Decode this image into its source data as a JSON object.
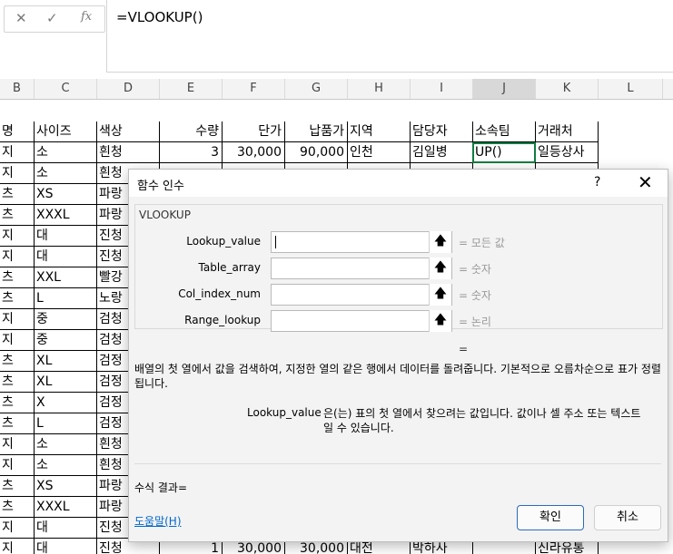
{
  "formula_bar": {
    "cancel_icon": "✕",
    "enter_icon": "✓",
    "fx_icon": "fx",
    "formula": "=VLOOKUP()"
  },
  "columns": [
    "B",
    "C",
    "D",
    "E",
    "F",
    "G",
    "H",
    "I",
    "J",
    "K",
    "L"
  ],
  "selected_column": "J",
  "header_row": [
    "명",
    "사이즈",
    "색상",
    "수량",
    "단가",
    "납품가",
    "지역",
    "담당자",
    "소속팀",
    "거래처"
  ],
  "rows": [
    [
      "지",
      "소",
      "흰청",
      "3",
      "30,000",
      "90,000",
      "인천",
      "김일병",
      "UP()",
      "일등상사"
    ],
    [
      "지",
      "소",
      "흰청",
      "",
      "",
      "",
      "",
      "",
      "",
      ""
    ],
    [
      "츠",
      "XS",
      "파랑",
      "",
      "",
      "",
      "",
      "",
      "",
      ""
    ],
    [
      "츠",
      "XXXL",
      "파랑",
      "",
      "",
      "",
      "",
      "",
      "",
      ""
    ],
    [
      "지",
      "대",
      "진청",
      "",
      "",
      "",
      "",
      "",
      "",
      ""
    ],
    [
      "지",
      "대",
      "진청",
      "",
      "",
      "",
      "",
      "",
      "",
      ""
    ],
    [
      "츠",
      "XXL",
      "빨강",
      "",
      "",
      "",
      "",
      "",
      "",
      ""
    ],
    [
      "츠",
      "L",
      "노랑",
      "",
      "",
      "",
      "",
      "",
      "",
      ""
    ],
    [
      "지",
      "중",
      "검청",
      "",
      "",
      "",
      "",
      "",
      "",
      ""
    ],
    [
      "지",
      "중",
      "검청",
      "",
      "",
      "",
      "",
      "",
      "",
      ""
    ],
    [
      "츠",
      "XL",
      "검정",
      "",
      "",
      "",
      "",
      "",
      "",
      ""
    ],
    [
      "츠",
      "XL",
      "검정",
      "",
      "",
      "",
      "",
      "",
      "",
      ""
    ],
    [
      "츠",
      "X",
      "검정",
      "",
      "",
      "",
      "",
      "",
      "",
      ""
    ],
    [
      "츠",
      "L",
      "검정",
      "",
      "",
      "",
      "",
      "",
      "",
      ""
    ],
    [
      "지",
      "소",
      "흰청",
      "",
      "",
      "",
      "",
      "",
      "",
      ""
    ],
    [
      "지",
      "소",
      "흰청",
      "",
      "",
      "",
      "",
      "",
      "",
      ""
    ],
    [
      "츠",
      "XS",
      "파랑",
      "",
      "",
      "",
      "",
      "",
      "",
      ""
    ],
    [
      "츠",
      "XXXL",
      "파랑",
      "",
      "",
      "",
      "",
      "",
      "",
      ""
    ],
    [
      "지",
      "대",
      "진청",
      "",
      "",
      "",
      "",
      "",
      "",
      ""
    ],
    [
      "지",
      "대",
      "진청",
      "1",
      "30,000",
      "30,000",
      "대전",
      "박하사",
      "",
      "신라유통"
    ]
  ],
  "dialog": {
    "title": "함수 인수",
    "help_label": "?",
    "close_label": "✕",
    "function_name": "VLOOKUP",
    "args": [
      {
        "label": "Lookup_value",
        "value": "",
        "result": "=  모든 값"
      },
      {
        "label": "Table_array",
        "value": "",
        "result": "=  숫자"
      },
      {
        "label": "Col_index_num",
        "value": "",
        "result": "=  숫자"
      },
      {
        "label": "Range_lookup",
        "value": "",
        "result": "=  논리"
      }
    ],
    "collapse_icon": "🡅",
    "result_equals": "=",
    "description": "배열의 첫 열에서 값을 검색하여, 지정한 열의 같은 행에서 데이터를 돌려줍니다. 기본적으로 오름차순으로 표가 정렬됩니다.",
    "param_name": "Lookup_value",
    "param_desc": "은(는) 표의 첫 열에서 찾으려는 값입니다. 값이나 셀 주소 또는 텍스트일 수 있습니다.",
    "formula_result": "수식 결과=",
    "help_link": "도움말(H)",
    "ok_label": "확인",
    "cancel_label": "취소"
  }
}
